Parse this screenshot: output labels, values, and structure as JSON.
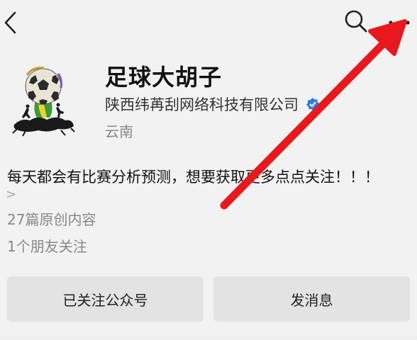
{
  "header": {
    "back_icon": "chevron-left-icon",
    "search_icon": "search-icon",
    "more_icon": "more-horizontal-icon"
  },
  "profile": {
    "name": "足球大胡子",
    "company": "陕西纬苒刮网络科技有限公司",
    "region": "云南",
    "avatar": "soccer-trophy-logo"
  },
  "description": {
    "text": "每天都会有比赛分析预测，想要获取更多点点关注！！！",
    "expand_glyph": ">"
  },
  "stats": {
    "articles": "27篇原创内容",
    "friends": "1个朋友关注"
  },
  "actions": {
    "follow_label": "已关注公众号",
    "message_label": "发消息"
  },
  "colors": {
    "background": "#f2f2f2",
    "button_bg": "#e3e3e3",
    "annotation_arrow": "#e8191c",
    "verified_badge": "#2f7be0"
  }
}
